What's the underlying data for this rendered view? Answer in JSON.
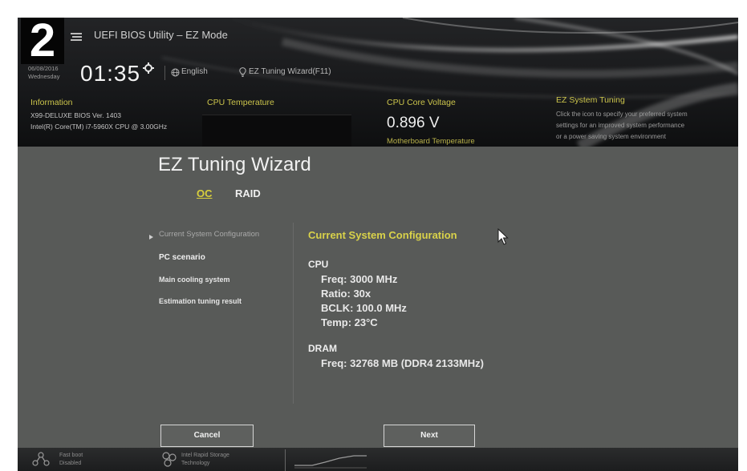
{
  "step_badge": "2",
  "header": {
    "title": "UEFI BIOS Utility – EZ Mode",
    "date": "06/08/2016",
    "day": "Wednesday",
    "time": "01:35",
    "language": "English",
    "wizard_shortcut": "EZ Tuning Wizard(F11)"
  },
  "info": {
    "information": {
      "label": "Information",
      "lines": [
        "X99-DELUXE   BIOS Ver. 1403",
        "Intel(R) Core(TM) i7-5960X CPU @ 3.00GHz"
      ]
    },
    "cpu_temperature": {
      "label": "CPU Temperature"
    },
    "cpu_core_voltage": {
      "label": "CPU Core Voltage",
      "value": "0.896 V"
    },
    "motherboard_temperature": {
      "label": "Motherboard Temperature"
    },
    "ez_system_tuning": {
      "label": "EZ System Tuning",
      "lines": [
        "Click the icon to specify your preferred system",
        "settings for an improved system performance",
        "or a power saving system environment"
      ]
    }
  },
  "wizard": {
    "title": "EZ Tuning Wizard",
    "tabs": [
      {
        "label": "OC",
        "active": true
      },
      {
        "label": "RAID",
        "active": false
      }
    ],
    "steps": [
      {
        "label": "Current System Configuration",
        "current": true
      },
      {
        "label": "PC scenario",
        "current": false
      },
      {
        "label": "Main cooling system",
        "current": false
      },
      {
        "label": "Estimation tuning result",
        "current": false
      }
    ],
    "panel": {
      "heading": "Current System Configuration",
      "cpu": {
        "label": "CPU",
        "lines": [
          "Freq: 3000 MHz",
          "Ratio: 30x",
          "BCLK: 100.0 MHz",
          "Temp: 23°C"
        ]
      },
      "dram": {
        "label": "DRAM",
        "lines": [
          "Freq: 32768 MB (DDR4 2133MHz)"
        ]
      }
    },
    "buttons": {
      "cancel": "Cancel",
      "next": "Next"
    }
  },
  "footer": {
    "items": [
      {
        "icon": "network-icon",
        "lines": [
          "Fast boot",
          "Disabled"
        ]
      },
      {
        "icon": "storage-cluster-icon",
        "lines": [
          "Intel Rapid Storage",
          "Technology"
        ]
      }
    ]
  },
  "icons": {
    "logo": "asus-logo-icon",
    "clock_settings": "gear-icon",
    "language": "globe-icon",
    "wizard": "lightbulb-icon",
    "pointer": "mouse-cursor-icon"
  },
  "colors": {
    "accent_yellow": "#d8d04a",
    "dialog_gray": "#585a58",
    "screen_dark": "#141517",
    "text_light": "#efefef"
  }
}
